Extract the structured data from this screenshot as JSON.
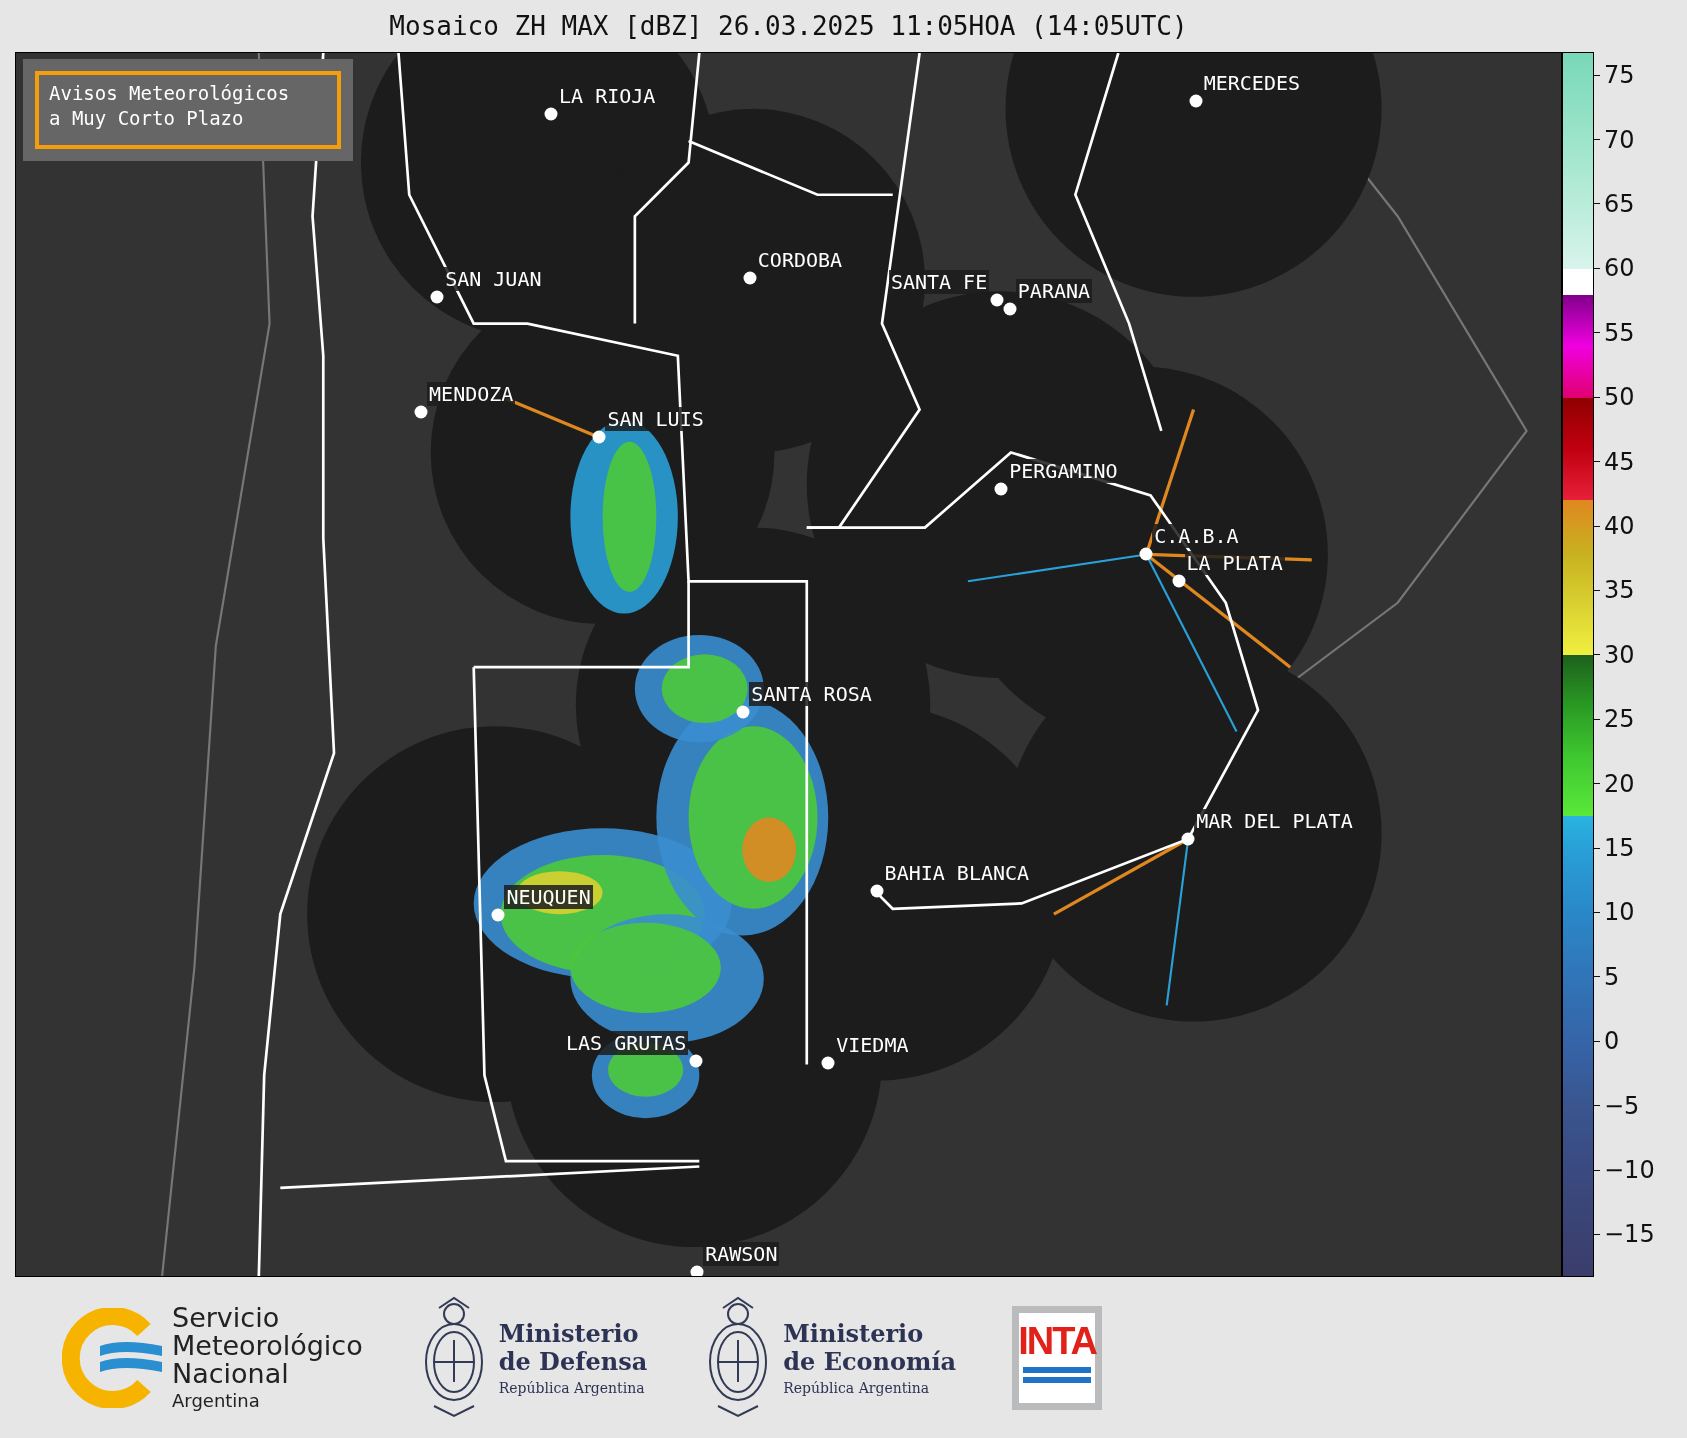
{
  "title": "Mosaico ZH MAX [dBZ] 26.03.2025 11:05HOA (14:05UTC)",
  "notice": {
    "lines": [
      "Avisos Meteorológicos",
      "a Muy Corto Plazo"
    ]
  },
  "cities": [
    {
      "name": "LA RIOJA"
    },
    {
      "name": "MERCEDES"
    },
    {
      "name": "CORDOBA"
    },
    {
      "name": "SAN JUAN"
    },
    {
      "name": "SANTA FE"
    },
    {
      "name": "PARANA"
    },
    {
      "name": "MENDOZA"
    },
    {
      "name": "SAN LUIS"
    },
    {
      "name": "PERGAMINO"
    },
    {
      "name": "C.A.B.A"
    },
    {
      "name": "LA PLATA"
    },
    {
      "name": "SANTA ROSA"
    },
    {
      "name": "MAR DEL PLATA"
    },
    {
      "name": "BAHIA BLANCA"
    },
    {
      "name": "NEUQUEN"
    },
    {
      "name": "LAS GRUTAS"
    },
    {
      "name": "VIEDMA"
    },
    {
      "name": "RAWSON"
    }
  ],
  "colorbar": {
    "ticks": [
      "75",
      "70",
      "65",
      "60",
      "55",
      "50",
      "45",
      "40",
      "35",
      "30",
      "25",
      "20",
      "15",
      "10",
      "5",
      "0",
      "−5",
      "−10",
      "−15"
    ]
  },
  "logos": [
    {
      "kind": "smn",
      "lines": [
        "Servicio",
        "Meteorológico",
        "Nacional"
      ],
      "subtitle": "Argentina"
    },
    {
      "kind": "ministry",
      "lines": [
        "Ministerio",
        "de Defensa"
      ],
      "subtitle": "República Argentina"
    },
    {
      "kind": "ministry",
      "lines": [
        "Ministerio",
        "de Economía"
      ],
      "subtitle": "República Argentina"
    },
    {
      "kind": "inta",
      "text": "INTA"
    }
  ]
}
